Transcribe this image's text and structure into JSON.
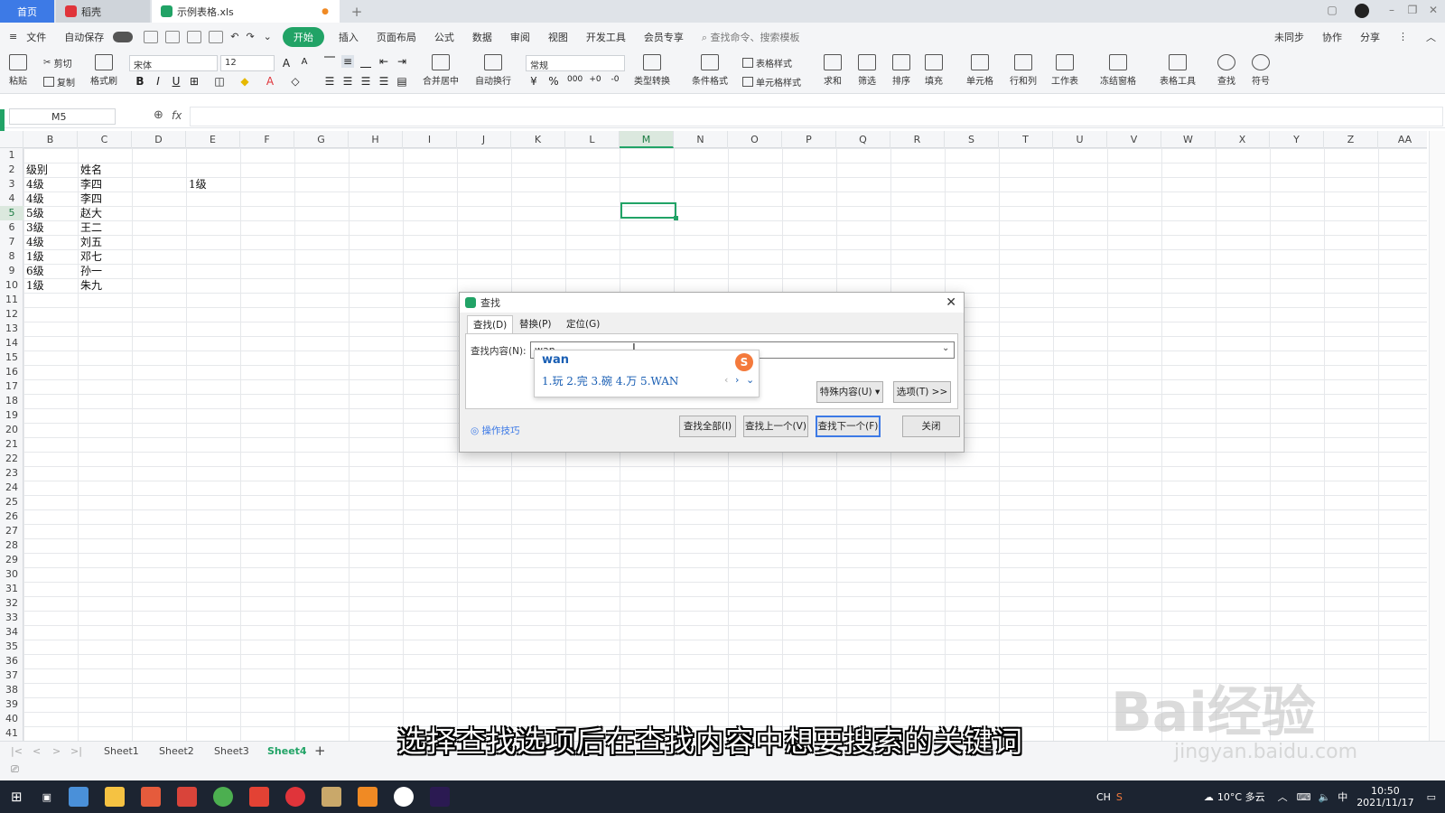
{
  "tabs": {
    "home": "首页",
    "docker": "稻壳",
    "file": "示例表格.xls"
  },
  "menubar": {
    "file": "文件",
    "autosave": "自动保存",
    "items": [
      "开始",
      "插入",
      "页面布局",
      "公式",
      "数据",
      "审阅",
      "视图",
      "开发工具",
      "会员专享"
    ],
    "search_placeholder": "查找命令、搜索模板",
    "right": [
      "未同步",
      "协作",
      "分享"
    ]
  },
  "ribbon": {
    "paste": "粘贴",
    "cut": "剪切",
    "copy": "复制",
    "format_painter": "格式刷",
    "font": "宋体",
    "size": "12",
    "merge": "合并居中",
    "wrap": "自动换行",
    "number_format": "常规",
    "convert": "类型转换",
    "cond_format": "条件格式",
    "table_style": "表格样式",
    "cell_style": "单元格样式",
    "sum": "求和",
    "filter": "筛选",
    "sort": "排序",
    "fill": "填充",
    "cell": "单元格",
    "rowcol": "行和列",
    "sheet": "工作表",
    "freeze": "冻结窗格",
    "tools": "表格工具",
    "find": "查找",
    "symbol": "符号"
  },
  "formula_bar": {
    "cell_ref": "M5",
    "fx": "fx"
  },
  "columns": [
    "B",
    "C",
    "D",
    "E",
    "F",
    "G",
    "H",
    "I",
    "J",
    "K",
    "L",
    "M",
    "N",
    "O",
    "P",
    "Q",
    "R",
    "S",
    "T",
    "U",
    "V",
    "W",
    "X",
    "Y",
    "Z",
    "AA"
  ],
  "selected_column": "M",
  "selected_row": "5",
  "rows": [
    "1",
    "2",
    "3",
    "4",
    "5",
    "6",
    "7",
    "8",
    "9",
    "10",
    "11",
    "12",
    "13",
    "14",
    "15",
    "16",
    "17",
    "18",
    "19",
    "20",
    "21",
    "22",
    "23",
    "24",
    "25",
    "26",
    "27",
    "28",
    "29",
    "30",
    "31",
    "32",
    "33",
    "34",
    "35",
    "36",
    "37",
    "38",
    "39",
    "40",
    "41",
    "42"
  ],
  "cells": {
    "B": [
      "",
      "级别",
      "4级",
      "4级",
      "5级",
      "3级",
      "4级",
      "1级",
      "6级",
      "1级"
    ],
    "C": [
      "",
      "姓名",
      "李四",
      "李四",
      "赵大",
      "王二",
      "刘五",
      "邓七",
      "孙一",
      "朱九"
    ],
    "E3": "1级"
  },
  "sheets": [
    "Sheet1",
    "Sheet2",
    "Sheet3",
    "Sheet4"
  ],
  "active_sheet": "Sheet4",
  "dialog": {
    "title": "查找",
    "tabs": [
      "查找(D)",
      "替换(P)",
      "定位(G)"
    ],
    "find_label": "查找内容(N):",
    "find_value": "wan",
    "special": "特殊内容(U) ▾",
    "options": "选项(T) >>",
    "tips": "操作技巧",
    "buttons": [
      "查找全部(I)",
      "查找上一个(V)",
      "查找下一个(F)",
      "关闭"
    ]
  },
  "ime": {
    "composition": "wan",
    "candidates": "1.玩  2.完  3.碗  4.万  5.WAN"
  },
  "subtitle": "选择查找选项后在查找内容中想要搜索的关键词",
  "watermark": {
    "main": "Bai经验",
    "sub": "jingyan.baidu.com"
  },
  "taskbar": {
    "weather": "10°C 多云",
    "time": "10:50",
    "date": "2021/11/17",
    "ime": "中",
    "ch": "CH"
  },
  "colors": {
    "accent": "#21a366",
    "home_tab": "#3d7ae6"
  }
}
